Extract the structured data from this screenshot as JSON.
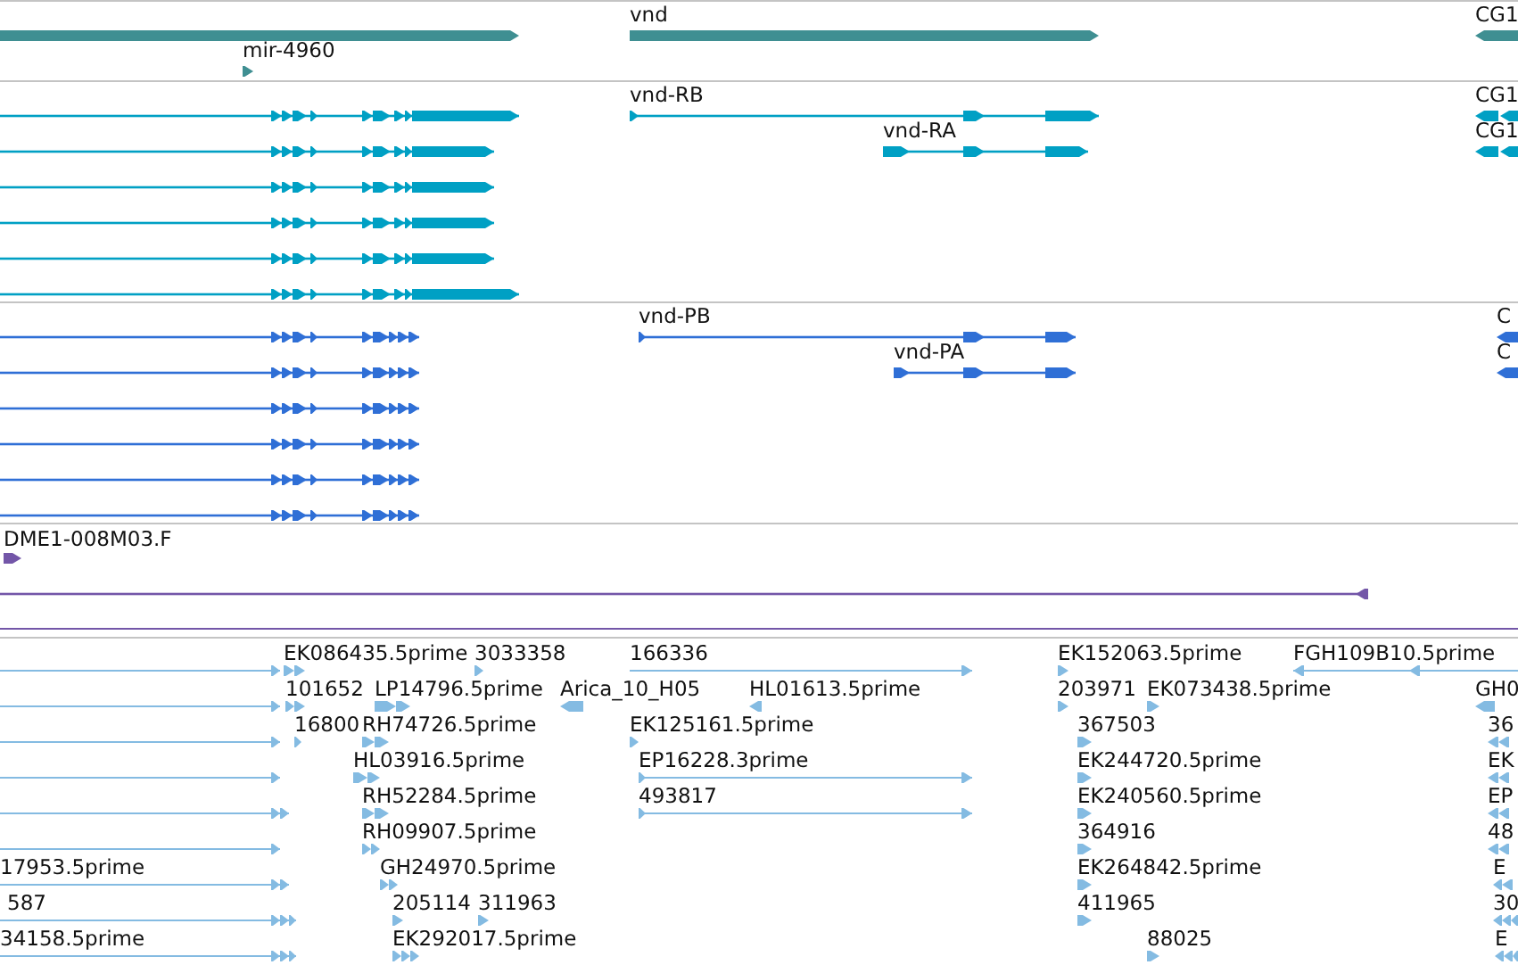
{
  "tracks": [
    {
      "kind": "gene",
      "features": [
        {
          "reverse": false
        },
        {
          "label": "mir-4960",
          "reverse": false
        },
        {
          "label": "vnd",
          "reverse": false
        },
        {
          "label": "CG1",
          "reverse": true
        }
      ]
    },
    {
      "kind": "transcript",
      "features": [
        {
          "reverse": false
        },
        {
          "reverse": false
        },
        {
          "reverse": false
        },
        {
          "reverse": false
        },
        {
          "reverse": false
        },
        {
          "reverse": false
        },
        {
          "label": "vnd-RB",
          "reverse": false
        },
        {
          "label": "vnd-RA",
          "reverse": false
        },
        {
          "label": "CG1",
          "reverse": true
        },
        {
          "label": "CG1",
          "reverse": true
        }
      ]
    },
    {
      "kind": "cds",
      "features": [
        {
          "reverse": false
        },
        {
          "reverse": false
        },
        {
          "reverse": false
        },
        {
          "reverse": false
        },
        {
          "reverse": false
        },
        {
          "reverse": false
        },
        {
          "label": "vnd-PB",
          "reverse": false
        },
        {
          "label": "vnd-PA",
          "reverse": false
        },
        {
          "label": "C",
          "reverse": true
        },
        {
          "label": "C",
          "reverse": true
        }
      ]
    },
    {
      "kind": "clone",
      "features": [
        {
          "label": "DME1-008M03.F",
          "reverse": false
        },
        {
          "reverse": true
        }
      ]
    },
    {
      "kind": "est",
      "features": [
        {
          "reverse": false
        },
        {
          "reverse": false
        },
        {
          "reverse": false
        },
        {
          "reverse": false
        },
        {
          "reverse": false
        },
        {
          "reverse": false
        },
        {
          "reverse": false
        },
        {
          "reverse": false
        },
        {
          "reverse": false
        },
        {
          "label": "EK086435.5prime",
          "reverse": false
        },
        {
          "label": "3033358",
          "reverse": false
        },
        {
          "label": "166336",
          "reverse": false
        },
        {
          "label": "EK152063.5prime",
          "reverse": false
        },
        {
          "label": "FGH109B10.5prime",
          "reverse": true
        },
        {
          "label": "101652",
          "reverse": false
        },
        {
          "label": "LP14796.5prime",
          "reverse": false
        },
        {
          "label": "Arica_10_H05",
          "reverse": true
        },
        {
          "label": "HL01613.5prime",
          "reverse": true
        },
        {
          "label": "203971",
          "reverse": false
        },
        {
          "label": "EK073438.5prime",
          "reverse": false
        },
        {
          "label": "GH0",
          "reverse": true
        },
        {
          "label": "16800",
          "reverse": false
        },
        {
          "label": "RH74726.5prime",
          "reverse": false
        },
        {
          "label": "EK125161.5prime",
          "reverse": false
        },
        {
          "label": "367503",
          "reverse": false
        },
        {
          "label": "36",
          "reverse": true
        },
        {
          "label": "HL03916.5prime",
          "reverse": false
        },
        {
          "label": "EP16228.3prime",
          "reverse": false
        },
        {
          "label": "EK244720.5prime",
          "reverse": false
        },
        {
          "label": "EK",
          "reverse": true
        },
        {
          "label": "RH52284.5prime",
          "reverse": false
        },
        {
          "label": "493817",
          "reverse": false
        },
        {
          "label": "EK240560.5prime",
          "reverse": false
        },
        {
          "label": "EP",
          "reverse": true
        },
        {
          "label": "RH09907.5prime",
          "reverse": false
        },
        {
          "label": "364916",
          "reverse": false
        },
        {
          "label": "48",
          "reverse": true
        },
        {
          "label": "17953.5prime"
        },
        {
          "label": "GH24970.5prime",
          "reverse": false
        },
        {
          "label": "EK264842.5prime",
          "reverse": false
        },
        {
          "label": "E",
          "reverse": true
        },
        {
          "label": "587"
        },
        {
          "label": "205114",
          "reverse": false
        },
        {
          "label": "311963",
          "reverse": false
        },
        {
          "label": "411965",
          "reverse": false
        },
        {
          "label": "30",
          "reverse": true
        },
        {
          "label": "34158.5prime"
        },
        {
          "label": "EK292017.5prime",
          "reverse": false
        },
        {
          "label": "88025",
          "reverse": false
        },
        {
          "label": "E",
          "reverse": true
        }
      ]
    }
  ]
}
